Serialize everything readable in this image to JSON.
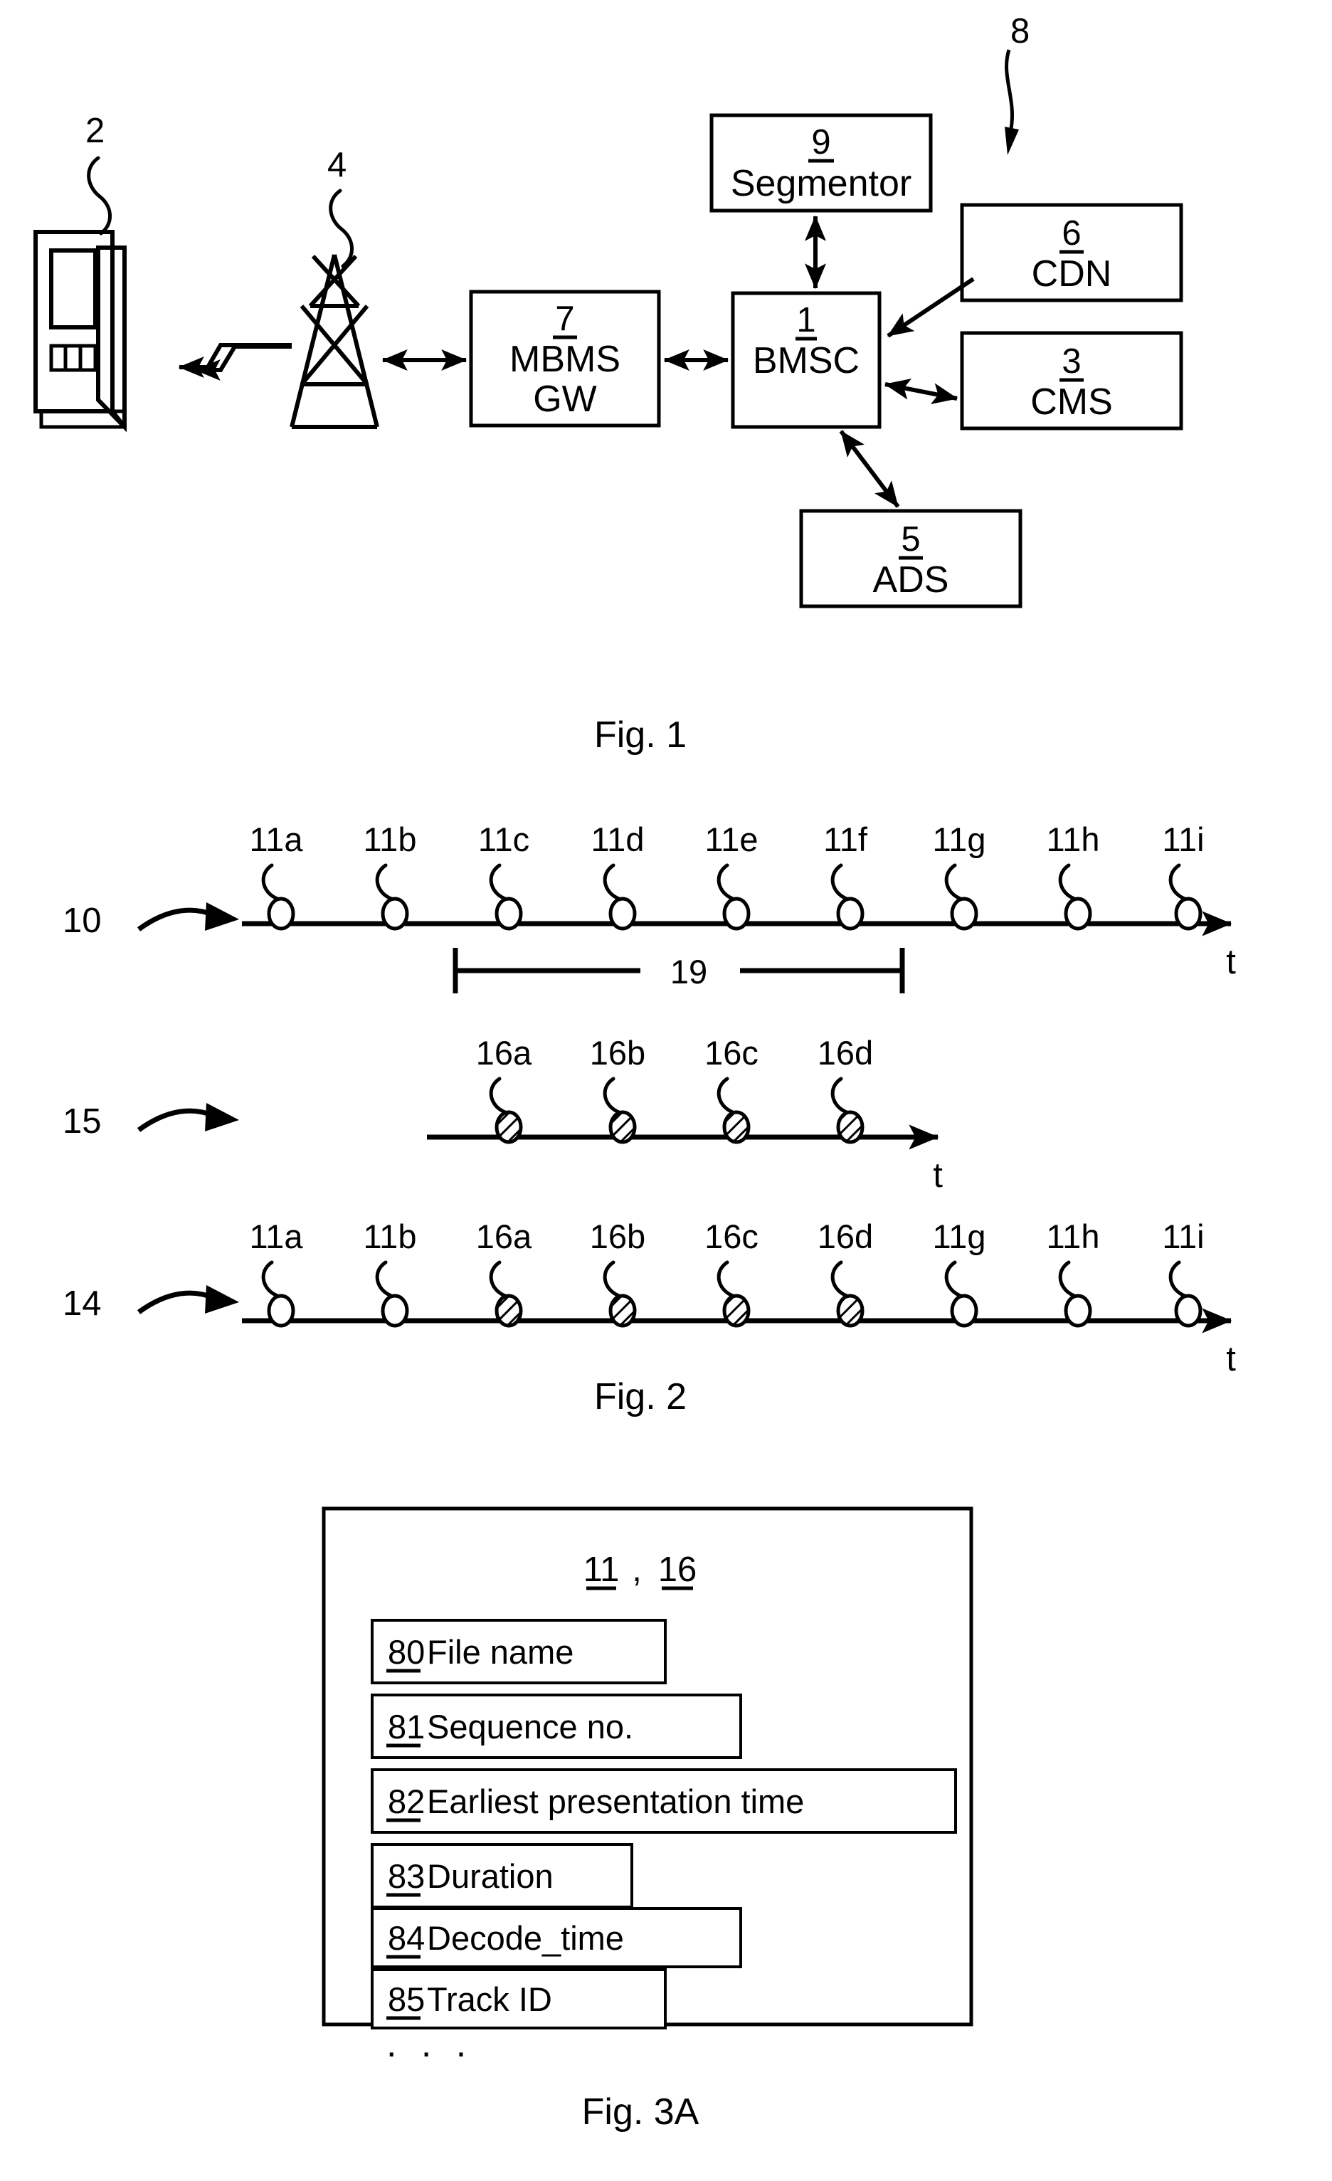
{
  "figures": [
    {
      "id": "fig1",
      "caption": "Fig. 1",
      "system_ref": "8",
      "device_ref": "2",
      "antenna_ref": "4",
      "nodes": [
        {
          "ref": "9",
          "name": "Segmentor"
        },
        {
          "ref": "6",
          "name": "CDN"
        },
        {
          "ref": "7",
          "name": "MBMS",
          "name2": "GW"
        },
        {
          "ref": "1",
          "name": "BMSC"
        },
        {
          "ref": "3",
          "name": "CMS"
        },
        {
          "ref": "5",
          "name": "ADS"
        }
      ]
    },
    {
      "id": "fig2",
      "caption": "Fig. 2",
      "timelines": [
        {
          "ref": "10",
          "axis_label": "t",
          "markers": [
            {
              "label": "11a",
              "kind": "open"
            },
            {
              "label": "11b",
              "kind": "open"
            },
            {
              "label": "11c",
              "kind": "open"
            },
            {
              "label": "11d",
              "kind": "open"
            },
            {
              "label": "11e",
              "kind": "open"
            },
            {
              "label": "11f",
              "kind": "open"
            },
            {
              "label": "11g",
              "kind": "open"
            },
            {
              "label": "11h",
              "kind": "open"
            },
            {
              "label": "11i",
              "kind": "open"
            }
          ],
          "span": {
            "label": "19"
          }
        },
        {
          "ref": "15",
          "axis_label": "t",
          "markers": [
            {
              "label": "16a",
              "kind": "hatched"
            },
            {
              "label": "16b",
              "kind": "hatched"
            },
            {
              "label": "16c",
              "kind": "hatched"
            },
            {
              "label": "16d",
              "kind": "hatched"
            }
          ]
        },
        {
          "ref": "14",
          "axis_label": "t",
          "markers": [
            {
              "label": "11a",
              "kind": "open"
            },
            {
              "label": "11b",
              "kind": "open"
            },
            {
              "label": "16a",
              "kind": "hatched"
            },
            {
              "label": "16b",
              "kind": "hatched"
            },
            {
              "label": "16c",
              "kind": "hatched"
            },
            {
              "label": "16d",
              "kind": "hatched"
            },
            {
              "label": "11g",
              "kind": "open"
            },
            {
              "label": "11h",
              "kind": "open"
            },
            {
              "label": "11i",
              "kind": "open"
            }
          ]
        }
      ]
    },
    {
      "id": "fig3a",
      "caption": "Fig. 3A",
      "header_refs": [
        "11",
        "16"
      ],
      "header_separator": ",",
      "fields": [
        {
          "ref": "80",
          "label": "File name"
        },
        {
          "ref": "81",
          "label": "Sequence no."
        },
        {
          "ref": "82",
          "label": "Earliest presentation time"
        },
        {
          "ref": "83",
          "label": "Duration"
        },
        {
          "ref": "84",
          "label": "Decode_time"
        },
        {
          "ref": "85",
          "label": "Track ID"
        }
      ],
      "ellipsis": ". . ."
    }
  ],
  "colors": {
    "ink": "#000000",
    "paper": "#ffffff"
  }
}
